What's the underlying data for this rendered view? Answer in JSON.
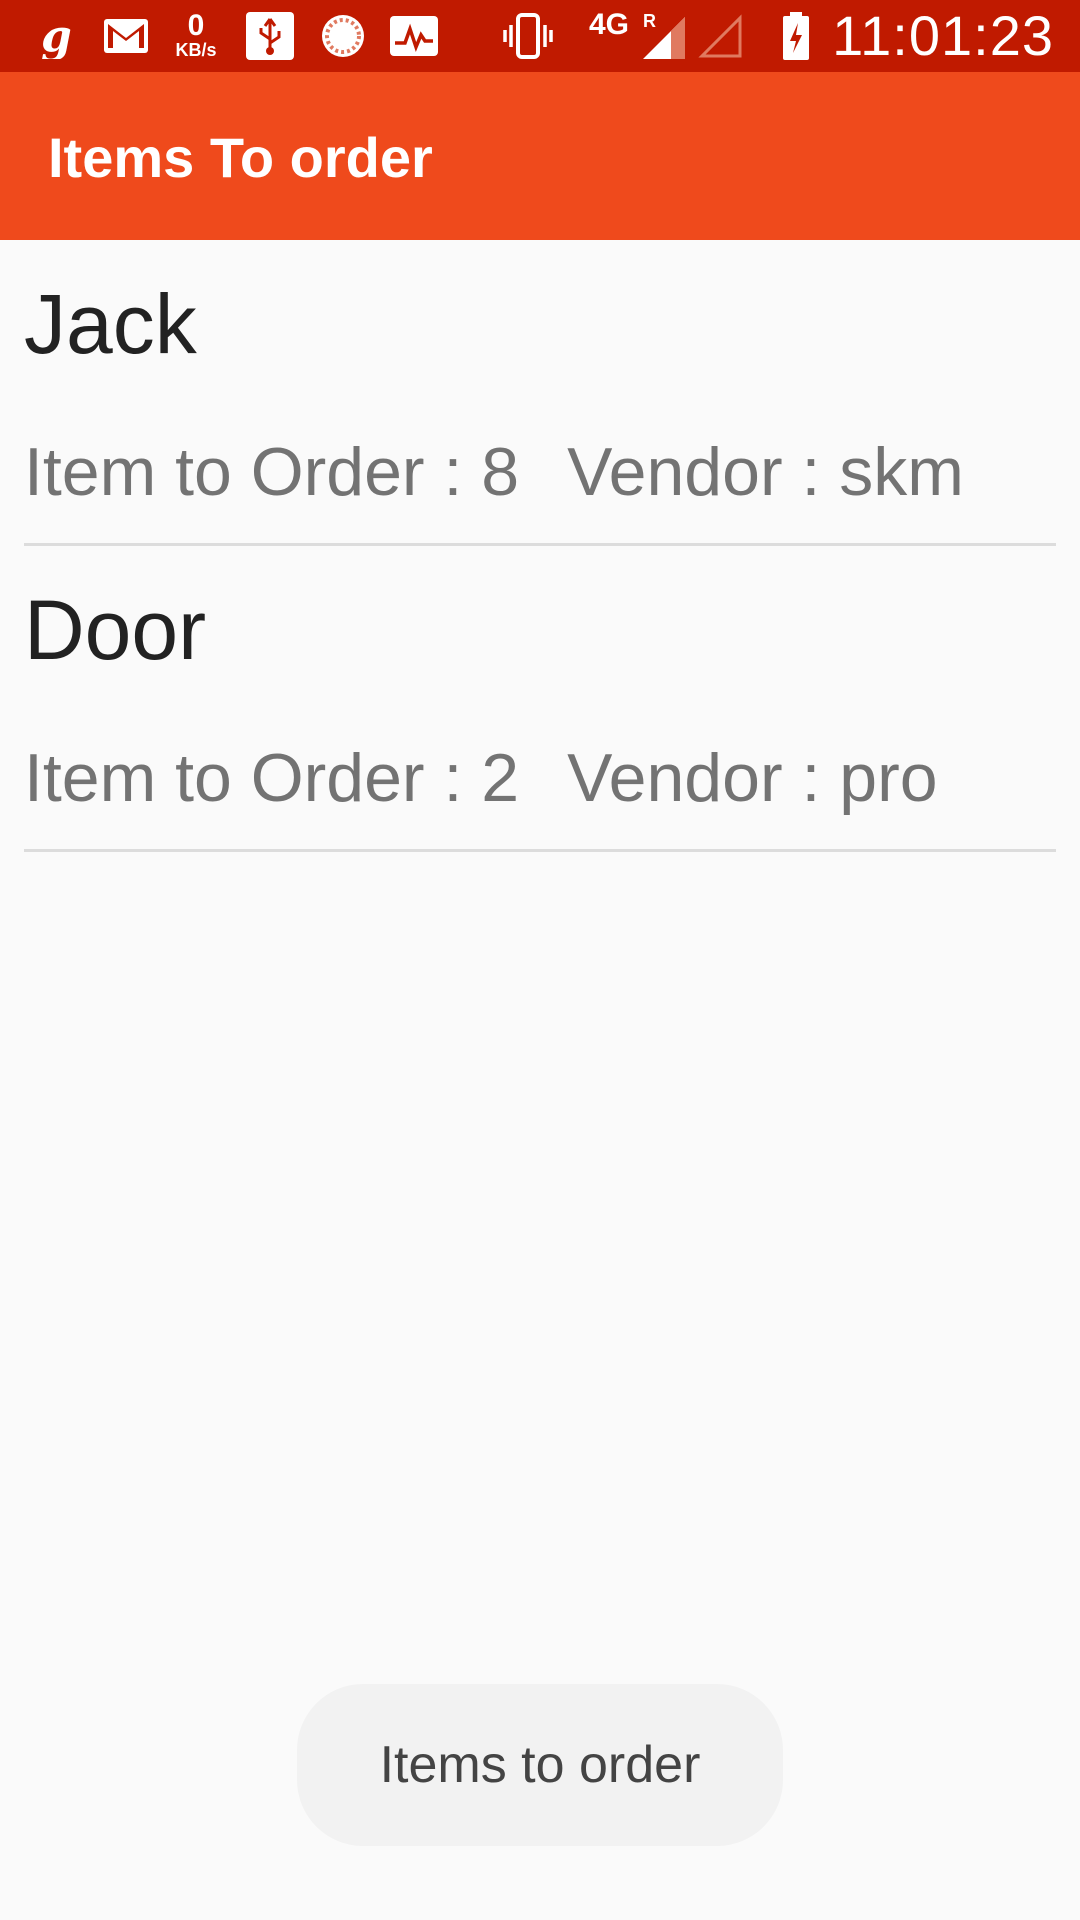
{
  "status_bar": {
    "time": "11:01:23",
    "network": "4G",
    "roaming_marker": "R",
    "speed_value": "0",
    "speed_unit": "KB/s",
    "icons": [
      "g-icon",
      "gmail-icon",
      "data-speed-icon",
      "usb-icon",
      "sync-icon",
      "pulse-icon",
      "vibrate-icon",
      "signal-icon",
      "signal-empty-icon",
      "battery-charging-icon"
    ]
  },
  "app_bar": {
    "title": "Items To order"
  },
  "items": [
    {
      "name": "Jack",
      "order_text": "Item to Order : 8",
      "vendor_text": "Vendor : skm"
    },
    {
      "name": "Door",
      "order_text": "Item to Order : 2",
      "vendor_text": "Vendor : pro"
    }
  ],
  "toast": {
    "message": "Items to order"
  },
  "colors": {
    "status_bar": "#c01a00",
    "app_bar": "#ef4a1c",
    "background": "#fafafa"
  }
}
